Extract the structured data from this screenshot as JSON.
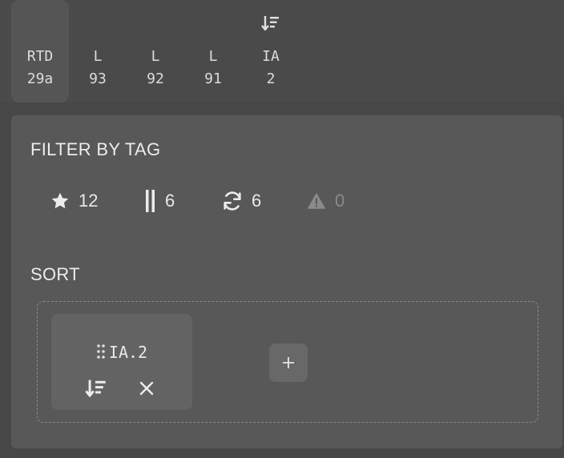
{
  "columns": [
    {
      "label": "RTD",
      "value": "29a",
      "active": true
    },
    {
      "label": "L",
      "value": "93"
    },
    {
      "label": "L",
      "value": "92"
    },
    {
      "label": "L",
      "value": "91"
    },
    {
      "label": "IA",
      "value": "2",
      "sorted": true,
      "sort_direction_icon": "sort-descending-icon"
    }
  ],
  "filter": {
    "title": "FILTER BY TAG",
    "tags": [
      {
        "icon": "star-icon",
        "count": "12"
      },
      {
        "icon": "pause-icon",
        "count": "6"
      },
      {
        "icon": "refresh-icon",
        "count": "6"
      },
      {
        "icon": "warning-icon",
        "count": "0",
        "disabled": true
      }
    ]
  },
  "sort": {
    "title": "SORT",
    "chip_label": "IA.2",
    "add_label": "+"
  },
  "colors": {
    "background": "#474747",
    "panel": "#585858",
    "chip": "#636363",
    "text": "#e6e6e6",
    "muted": "#8a8a8a"
  }
}
